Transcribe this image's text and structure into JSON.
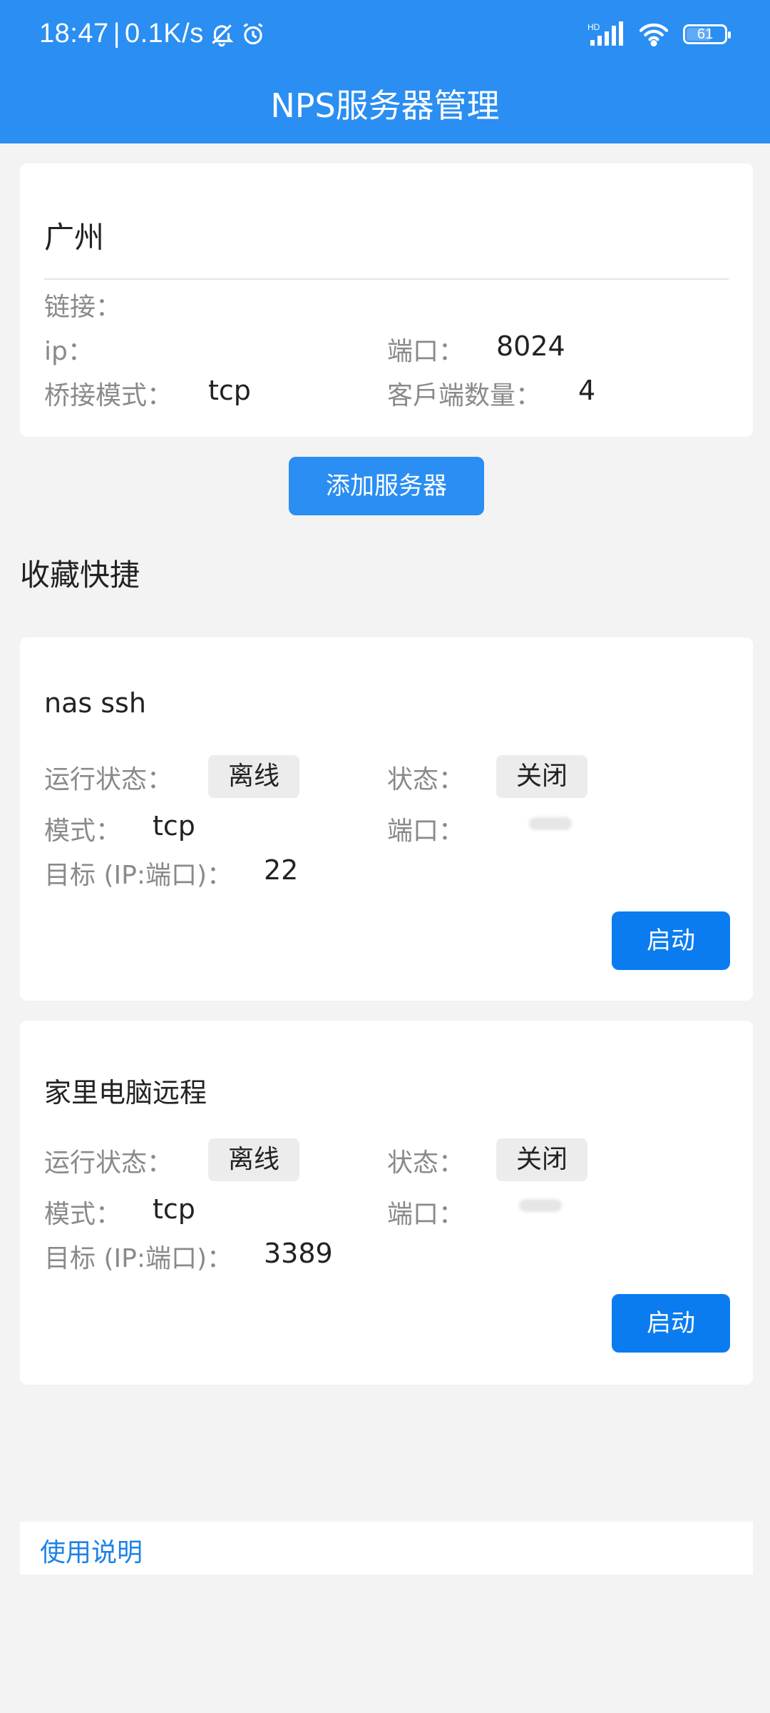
{
  "status_bar": {
    "time": "18:47",
    "net_speed": "0.1K/s",
    "network_label": "HD",
    "battery": "61"
  },
  "appbar": {
    "title": "NPS服务器管理"
  },
  "server": {
    "name": "广州",
    "link_label": "链接：",
    "link_value": "",
    "ip_label": "ip：",
    "ip_value": "",
    "port_label": "端口：",
    "port_value": "8024",
    "bridge_label": "桥接模式：",
    "bridge_value": "tcp",
    "clients_label": "客戶端数量：",
    "clients_value": "4"
  },
  "add_server_button": "添加服务器",
  "favorites": {
    "title": "收藏快捷",
    "items": [
      {
        "name": "nas ssh",
        "run_state_label": "运行状态：",
        "run_state": "离线",
        "state_label": "状态：",
        "state": "关闭",
        "mode_label": "模式：",
        "mode": "tcp",
        "port_label": "端口：",
        "target_label": "目标 (IP:端口)：",
        "target": "22",
        "start_label": "启动"
      },
      {
        "name": "家里电脑远程",
        "run_state_label": "运行状态：",
        "run_state": "离线",
        "state_label": "状态：",
        "state": "关闭",
        "mode_label": "模式：",
        "mode": "tcp",
        "port_label": "端口：",
        "target_label": "目标 (IP:端口)：",
        "target": "3389",
        "start_label": "启动"
      }
    ]
  },
  "help_link": "使用说明",
  "colors": {
    "appbar": "#2a8ef2",
    "primary_button": "#0b7cf0",
    "background": "#f3f3f3",
    "link": "#1e82e6"
  }
}
